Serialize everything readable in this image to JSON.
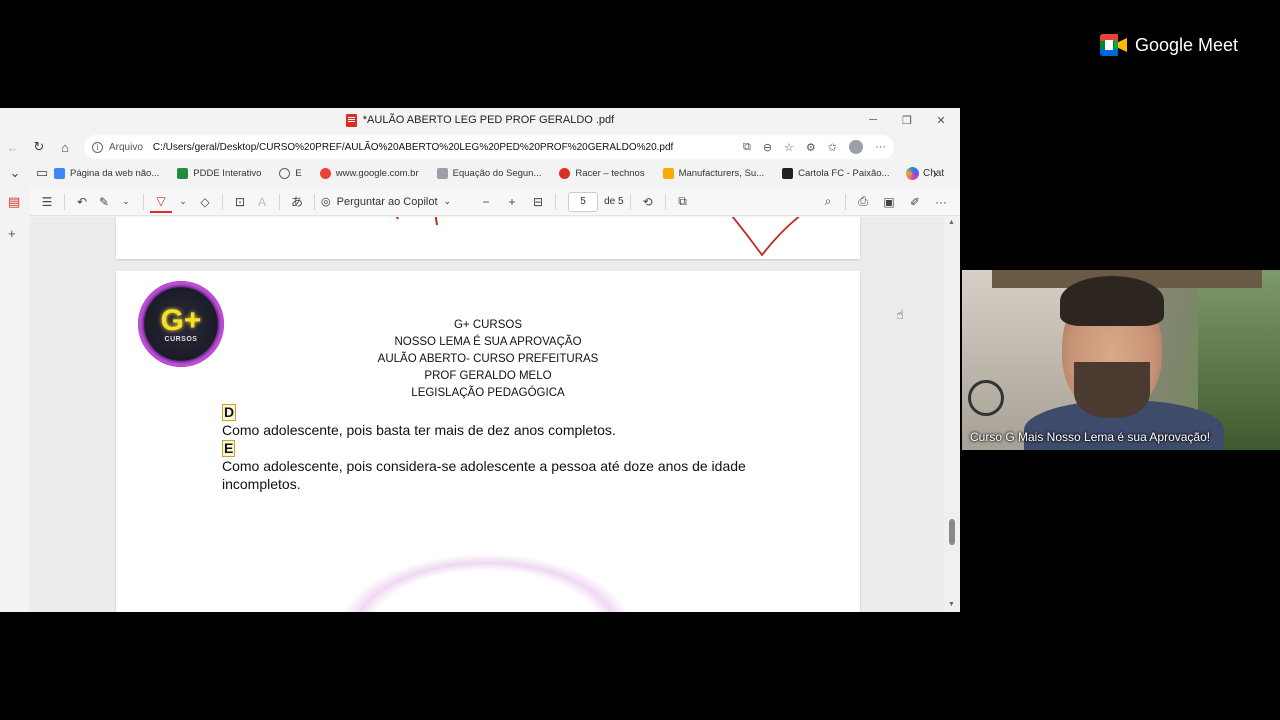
{
  "browser": {
    "title": "*AULÃO ABERTO LEG PED PROF GERALDO .pdf",
    "address": {
      "chip": "Arquivo",
      "url": "C:/Users/geral/Desktop/CURSO%20PREF/AULÃO%20ABERTO%20LEG%20PED%20PROF%20GERALDO%20.pdf"
    },
    "chat_label": "Chat",
    "bookmarks": [
      {
        "label": "Página da web não...",
        "color": "#4285f4"
      },
      {
        "label": "PDDE Interativo",
        "color": "#1e8e3e"
      },
      {
        "label": "E",
        "color": "#5f6368"
      },
      {
        "label": "www.google.com.br",
        "color": "#ea4335"
      },
      {
        "label": "Equação do Segun...",
        "color": "#5f6368"
      },
      {
        "label": "Racer – technos",
        "color": "#d93025"
      },
      {
        "label": "Manufacturers, Su...",
        "color": "#f9ab00"
      },
      {
        "label": "Cartola FC - Paixão...",
        "color": "#202124"
      }
    ]
  },
  "pdf_toolbar": {
    "ask_copilot": "Perguntar ao Copilot",
    "page_current": "5",
    "page_total": "de 5"
  },
  "document": {
    "logo_text": "G+",
    "logo_sub": "CURSOS",
    "header": [
      "G+ CURSOS",
      "NOSSO LEMA É SUA APROVAÇÃO",
      "AULÃO ABERTO- CURSO PREFEITURAS",
      "PROF GERALDO MELO",
      "LEGISLAÇÃO PEDAGÓGICA"
    ],
    "option_d_letter": "D",
    "option_d_text": "Como adolescente, pois basta ter mais de dez anos completos.",
    "option_e_letter": "E",
    "option_e_text": "Como adolescente, pois considera-se adolescente a pessoa até doze anos de idade incompletos."
  },
  "meet": {
    "brand": "Google Meet",
    "participant_caption": "Curso G Mais Nosso Lema é sua Aprovação!"
  }
}
